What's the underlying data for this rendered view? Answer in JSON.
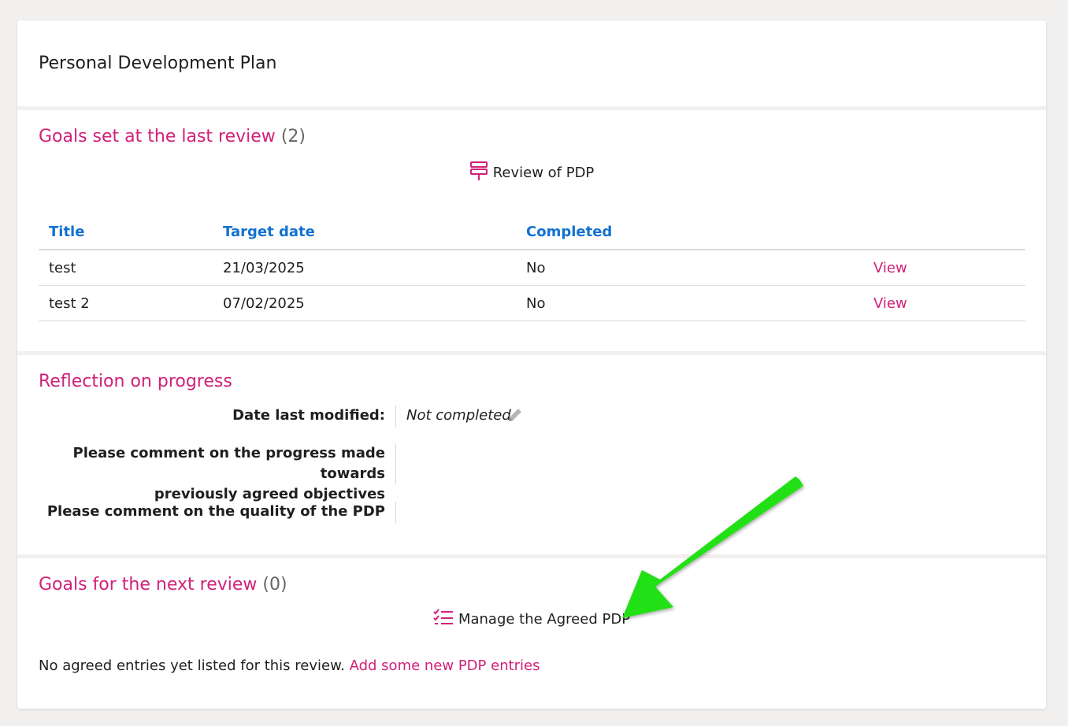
{
  "page": {
    "title": "Personal Development Plan"
  },
  "goals_last": {
    "heading": "Goals set at the last review",
    "count": "(2)",
    "review_action": "Review of PDP",
    "columns": [
      "Title",
      "Target date",
      "Completed"
    ],
    "rows": [
      {
        "title": "test",
        "target": "21/03/2025",
        "completed": "No",
        "action": "View"
      },
      {
        "title": "test 2",
        "target": "07/02/2025",
        "completed": "No",
        "action": "View"
      }
    ]
  },
  "reflection": {
    "heading": "Reflection on progress",
    "date_label": "Date last modified:",
    "date_value": "Not completed",
    "progress_label_line1": "Please comment on the progress made towards",
    "progress_label_line2": "previously agreed objectives",
    "quality_label": "Please comment on the quality of the PDP"
  },
  "goals_next": {
    "heading": "Goals for the next review",
    "count": "(0)",
    "manage_action": "Manage the Agreed PDP",
    "empty_text": "No agreed entries yet listed for this review.",
    "add_link": "Add some new PDP entries"
  },
  "colors": {
    "accent": "#d1217a",
    "link_blue": "#1271d1",
    "annotation_arrow": "#22e012"
  },
  "icons": {
    "review": "signpost-icon",
    "manage": "checklist-icon",
    "edit": "pencil-icon"
  }
}
